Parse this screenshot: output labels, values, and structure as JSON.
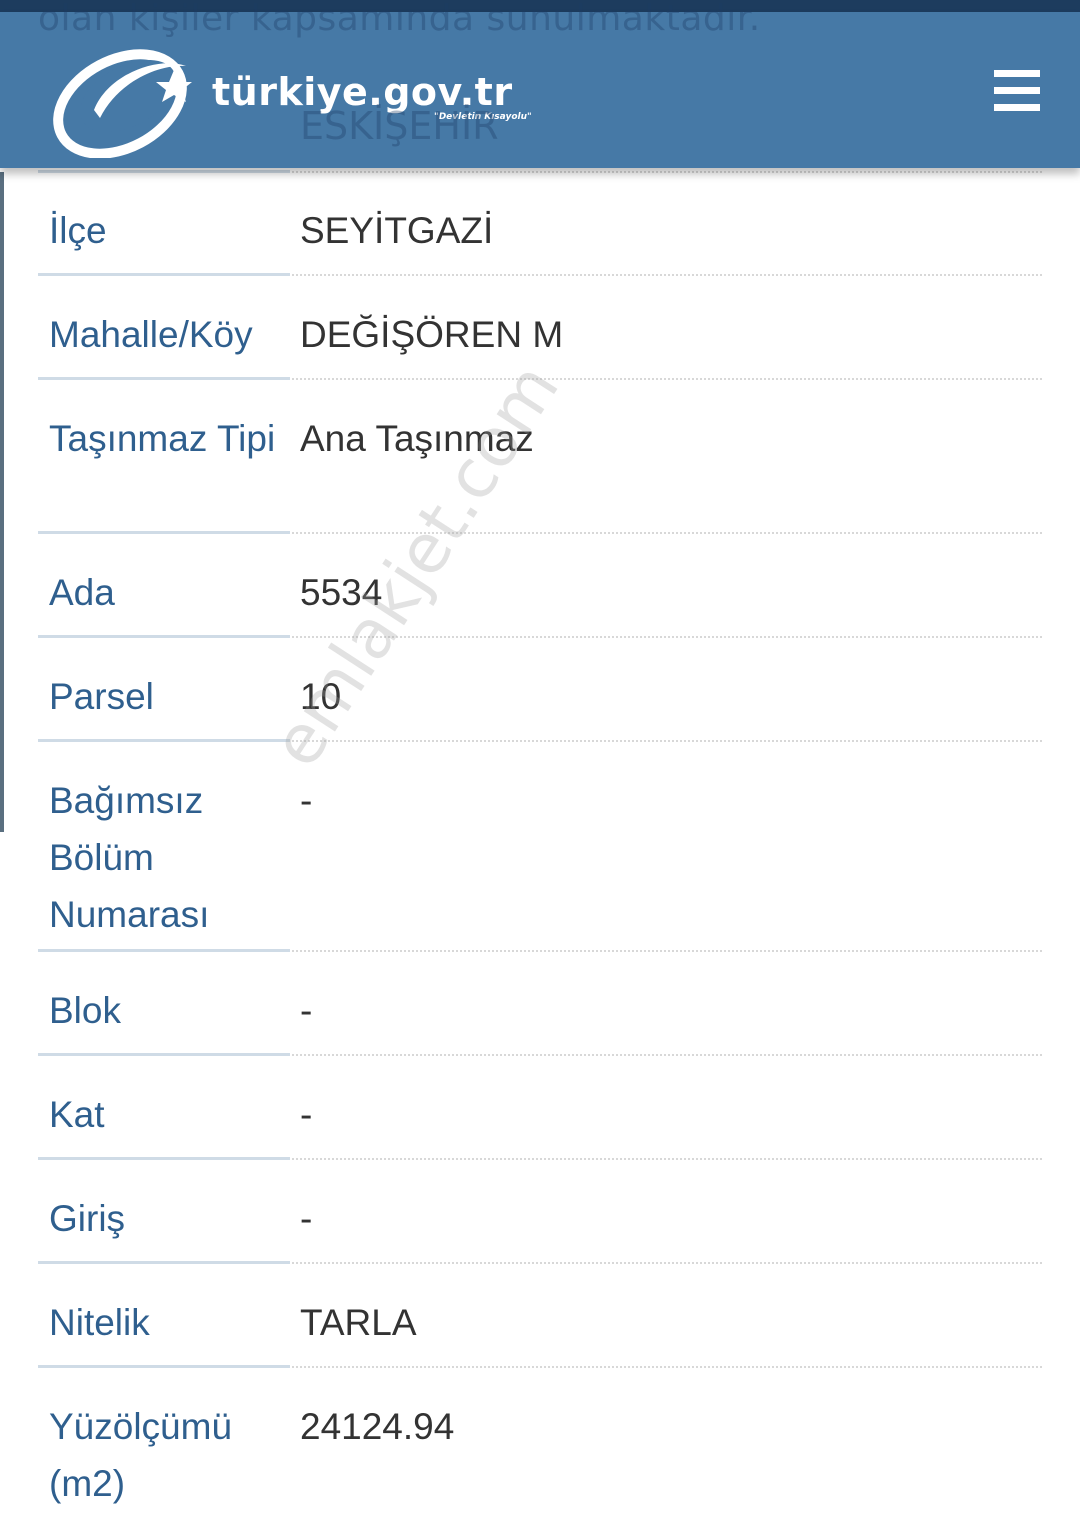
{
  "background_text": {
    "line": "olan kişiler kapsamında sunulmaktadır.",
    "city": "ESKİŞEHİR"
  },
  "header": {
    "logo_text": "türkiye.gov.tr",
    "logo_tagline": "\"Devletin Kısayolu\"",
    "menu_icon": "hamburger-menu-icon",
    "background_color": "#4679a6"
  },
  "property": {
    "rows": [
      {
        "label": "İlçe",
        "value": "SEYİTGAZİ"
      },
      {
        "label": "Mahalle/Köy",
        "value": "DEĞİŞÖREN M"
      },
      {
        "label": "Taşınmaz Tipi",
        "value": "Ana Taşınmaz"
      },
      {
        "label": "Ada",
        "value": "5534"
      },
      {
        "label": "Parsel",
        "value": "10"
      },
      {
        "label": "Bağımsız Bölüm Numarası",
        "value": "-"
      },
      {
        "label": "Blok",
        "value": "-"
      },
      {
        "label": "Kat",
        "value": "-"
      },
      {
        "label": "Giriş",
        "value": "-"
      },
      {
        "label": "Nitelik",
        "value": "TARLA"
      },
      {
        "label": "Yüzölçümü (m2)",
        "value": "24124.94"
      }
    ]
  },
  "watermark": "emlakjet.com",
  "colors": {
    "label": "#2f5f8e",
    "value": "#333333",
    "header": "#4679a6"
  }
}
